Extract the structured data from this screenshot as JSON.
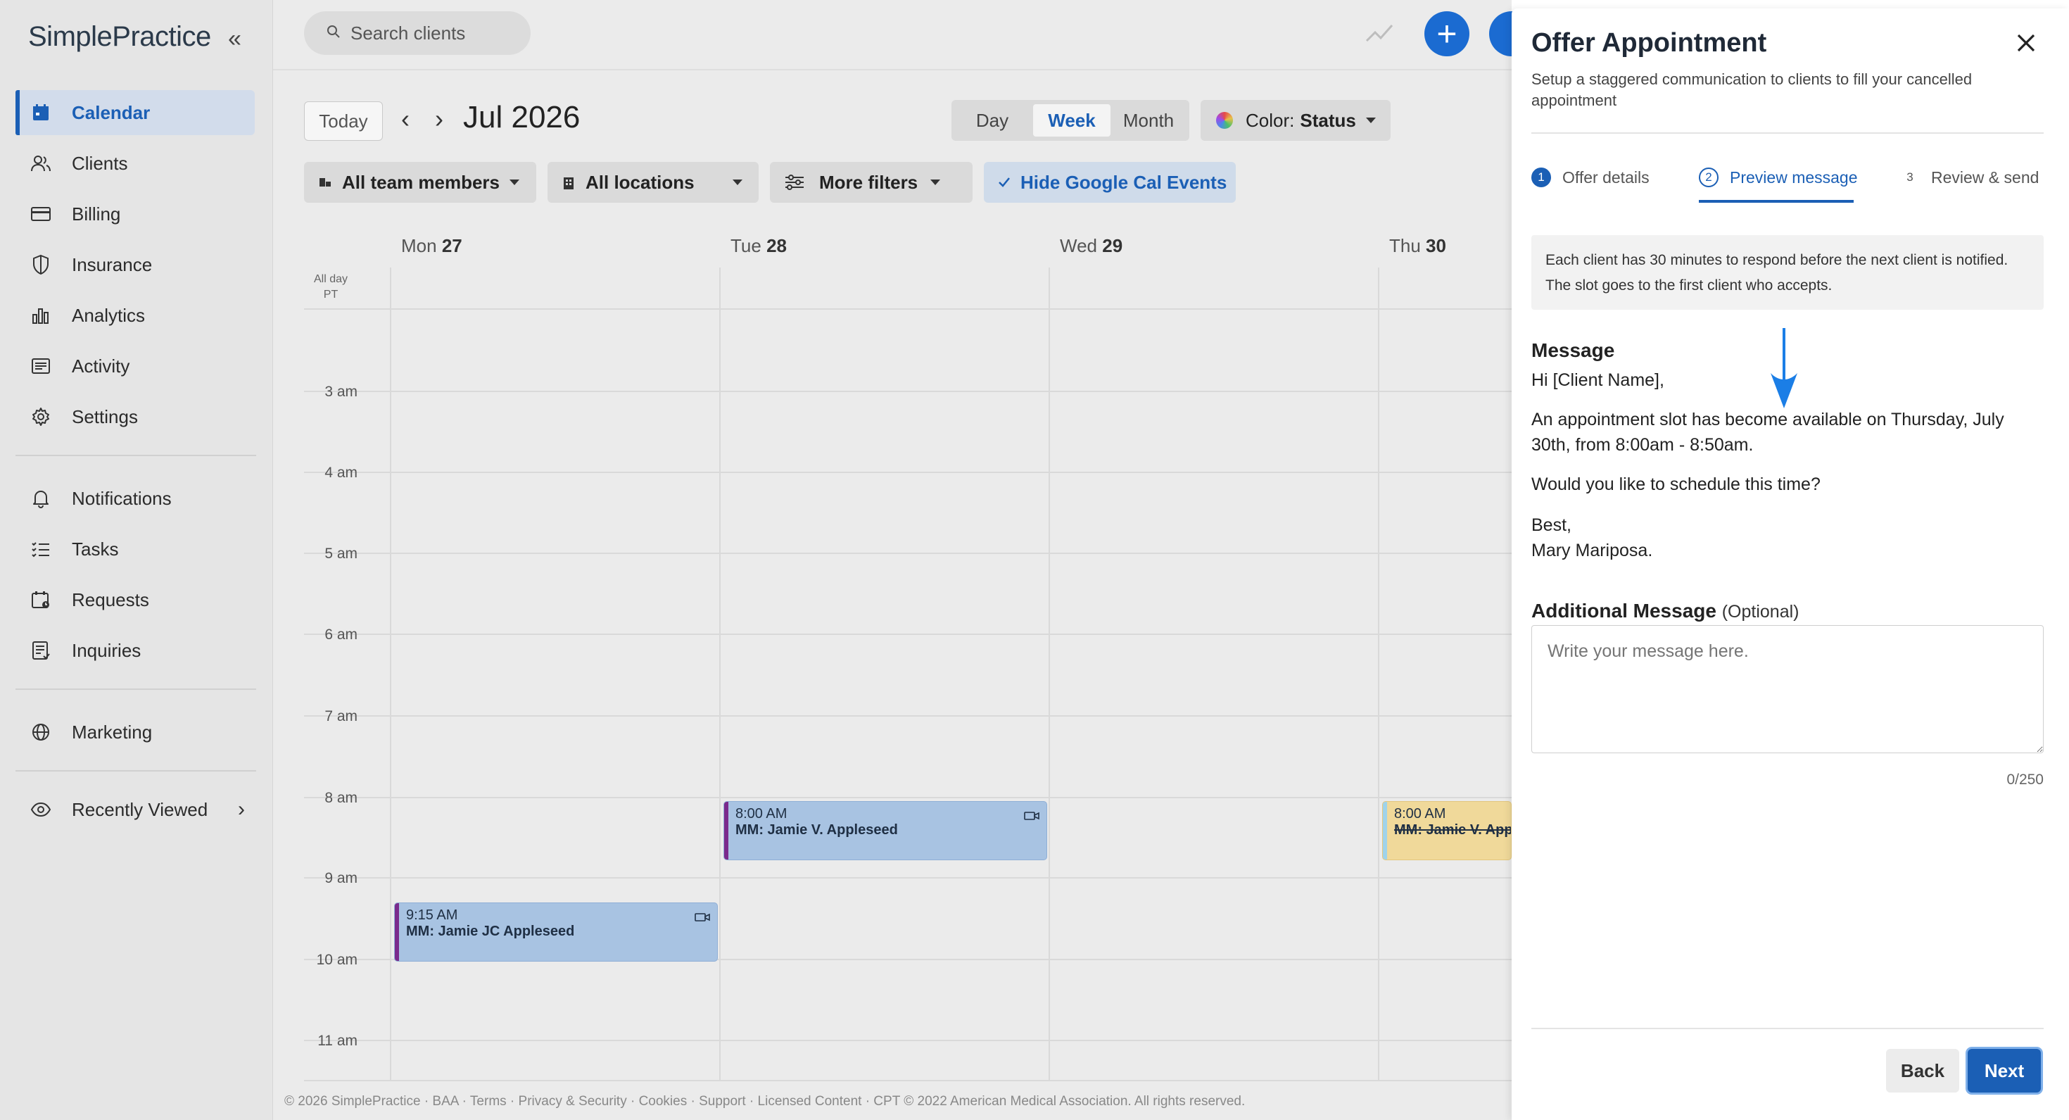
{
  "app": {
    "logo_text": "SimplePractice"
  },
  "sidebar": {
    "items": [
      {
        "label": "Calendar",
        "icon": "calendar-icon",
        "active": true
      },
      {
        "label": "Clients",
        "icon": "clients-icon"
      },
      {
        "label": "Billing",
        "icon": "billing-icon"
      },
      {
        "label": "Insurance",
        "icon": "shield-icon"
      },
      {
        "label": "Analytics",
        "icon": "analytics-icon"
      },
      {
        "label": "Activity",
        "icon": "activity-icon"
      },
      {
        "label": "Settings",
        "icon": "gear-icon"
      },
      {
        "label": "Notifications",
        "icon": "bell-icon"
      },
      {
        "label": "Tasks",
        "icon": "tasks-icon"
      },
      {
        "label": "Requests",
        "icon": "requests-icon"
      },
      {
        "label": "Inquiries",
        "icon": "inquiries-icon"
      },
      {
        "label": "Marketing",
        "icon": "globe-icon"
      },
      {
        "label": "Recently Viewed",
        "icon": "eye-icon"
      }
    ]
  },
  "topbar": {
    "search_placeholder": "Search clients"
  },
  "toolbar": {
    "today_label": "Today",
    "month_title": "Jul 2026",
    "views": {
      "day": "Day",
      "week": "Week",
      "month": "Month",
      "active": "Week"
    },
    "color_label": "Color:",
    "color_value": "Status"
  },
  "filters": {
    "team": "All team members",
    "locations": "All locations",
    "more": "More filters",
    "hide_google": "Hide Google Cal Events"
  },
  "calendar": {
    "all_day": "All day",
    "timezone": "PT",
    "days": [
      {
        "dow": "Mon",
        "date": "27"
      },
      {
        "dow": "Tue",
        "date": "28"
      },
      {
        "dow": "Wed",
        "date": "29"
      },
      {
        "dow": "Thu",
        "date": "30"
      }
    ],
    "hours": [
      "3 am",
      "4 am",
      "5 am",
      "6 am",
      "7 am",
      "8 am",
      "9 am",
      "10 am",
      "11 am"
    ],
    "appointments": [
      {
        "time": "8:00 AM",
        "title": "MM: Jamie V. Appleseed",
        "day": "Tue",
        "status_color": "#a8c3e2"
      },
      {
        "time": "9:15 AM",
        "title": "MM: Jamie JC Appleseed",
        "day": "Mon",
        "status_color": "#a8c3e2"
      },
      {
        "time": "8:00 AM",
        "title": "MM: Jamie V. App",
        "day": "Thu",
        "status_color": "#f0d99a",
        "cancelled": true
      }
    ]
  },
  "footer": {
    "text": "© 2026 SimplePractice · BAA · Terms · Privacy & Security · Cookies · Support · Licensed Content · CPT © 2022 American Medical Association. All rights reserved."
  },
  "panel": {
    "title": "Offer Appointment",
    "subtitle": "Setup a staggered communication to clients to fill your cancelled appointment",
    "steps": [
      {
        "num": "1",
        "label": "Offer details"
      },
      {
        "num": "2",
        "label": "Preview message"
      },
      {
        "num": "3",
        "label": "Review & send"
      }
    ],
    "info": "Each client has 30 minutes to respond before the next client is notified. The slot goes to the first client who accepts.",
    "message_heading": "Message",
    "message": {
      "greeting": "Hi [Client Name],",
      "body": "An appointment slot has become available on Thursday, July 30th, from 8:00am - 8:50am.",
      "question": "Would you like to schedule this time?",
      "closing": "Best,",
      "signature": "Mary Mariposa."
    },
    "additional_heading": "Additional Message",
    "additional_optional": "(Optional)",
    "additional_placeholder": "Write your message here.",
    "char_count": "0/250",
    "back_label": "Back",
    "next_label": "Next"
  },
  "colors": {
    "accent": "#1b5fb5",
    "sidebar_bg": "#e5e5e5",
    "main_bg": "#ebebeb"
  }
}
